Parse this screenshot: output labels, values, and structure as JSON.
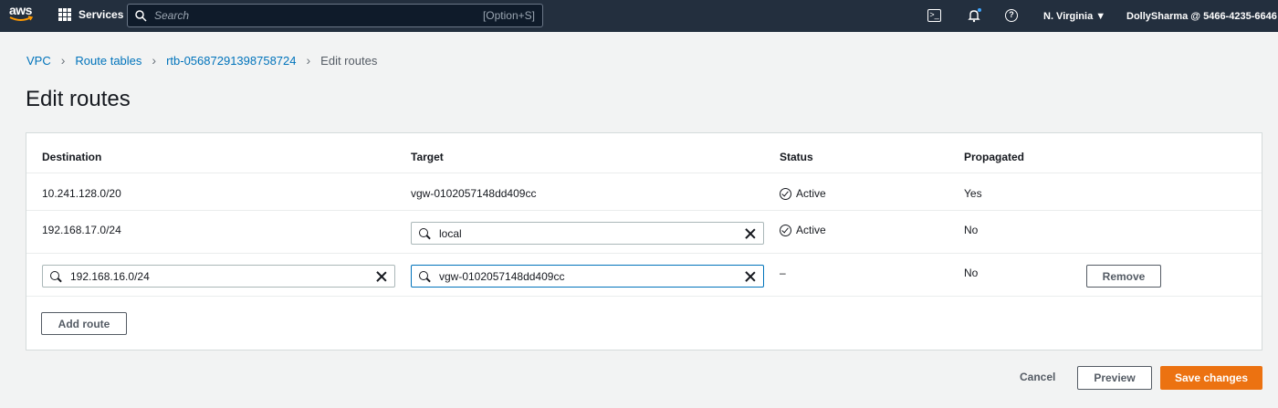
{
  "nav": {
    "logo": "aws",
    "services": "Services",
    "search_placeholder": "Search",
    "search_shortcut": "[Option+S]",
    "region": "N. Virginia ▼",
    "account": "DollySharma @ 5466-4235-6646",
    "colors": {
      "bar": "#232f3e",
      "notification_dot": "#3ea6ff"
    }
  },
  "breadcrumb": [
    {
      "label": "VPC"
    },
    {
      "label": "Route tables"
    },
    {
      "label": "rtb-05687291398758724"
    },
    {
      "label": "Edit routes"
    }
  ],
  "page_title": "Edit routes",
  "table": {
    "headers": {
      "destination": "Destination",
      "target": "Target",
      "status": "Status",
      "propagated": "Propagated"
    },
    "rows": [
      {
        "destination": "10.241.128.0/20",
        "target": "vgw-0102057148dd409cc",
        "status": "Active",
        "propagated": "Yes"
      },
      {
        "destination": "192.168.17.0/24",
        "target_input": "local",
        "status": "Active",
        "propagated": "No"
      },
      {
        "destination_input": "192.168.16.0/24",
        "target_input": "vgw-0102057148dd409cc",
        "status": "–",
        "propagated": "No",
        "remove_label": "Remove"
      }
    ],
    "add_route_label": "Add route"
  },
  "footer": {
    "cancel": "Cancel",
    "preview": "Preview",
    "save": "Save changes",
    "colors": {
      "primary": "#ec7211"
    }
  }
}
